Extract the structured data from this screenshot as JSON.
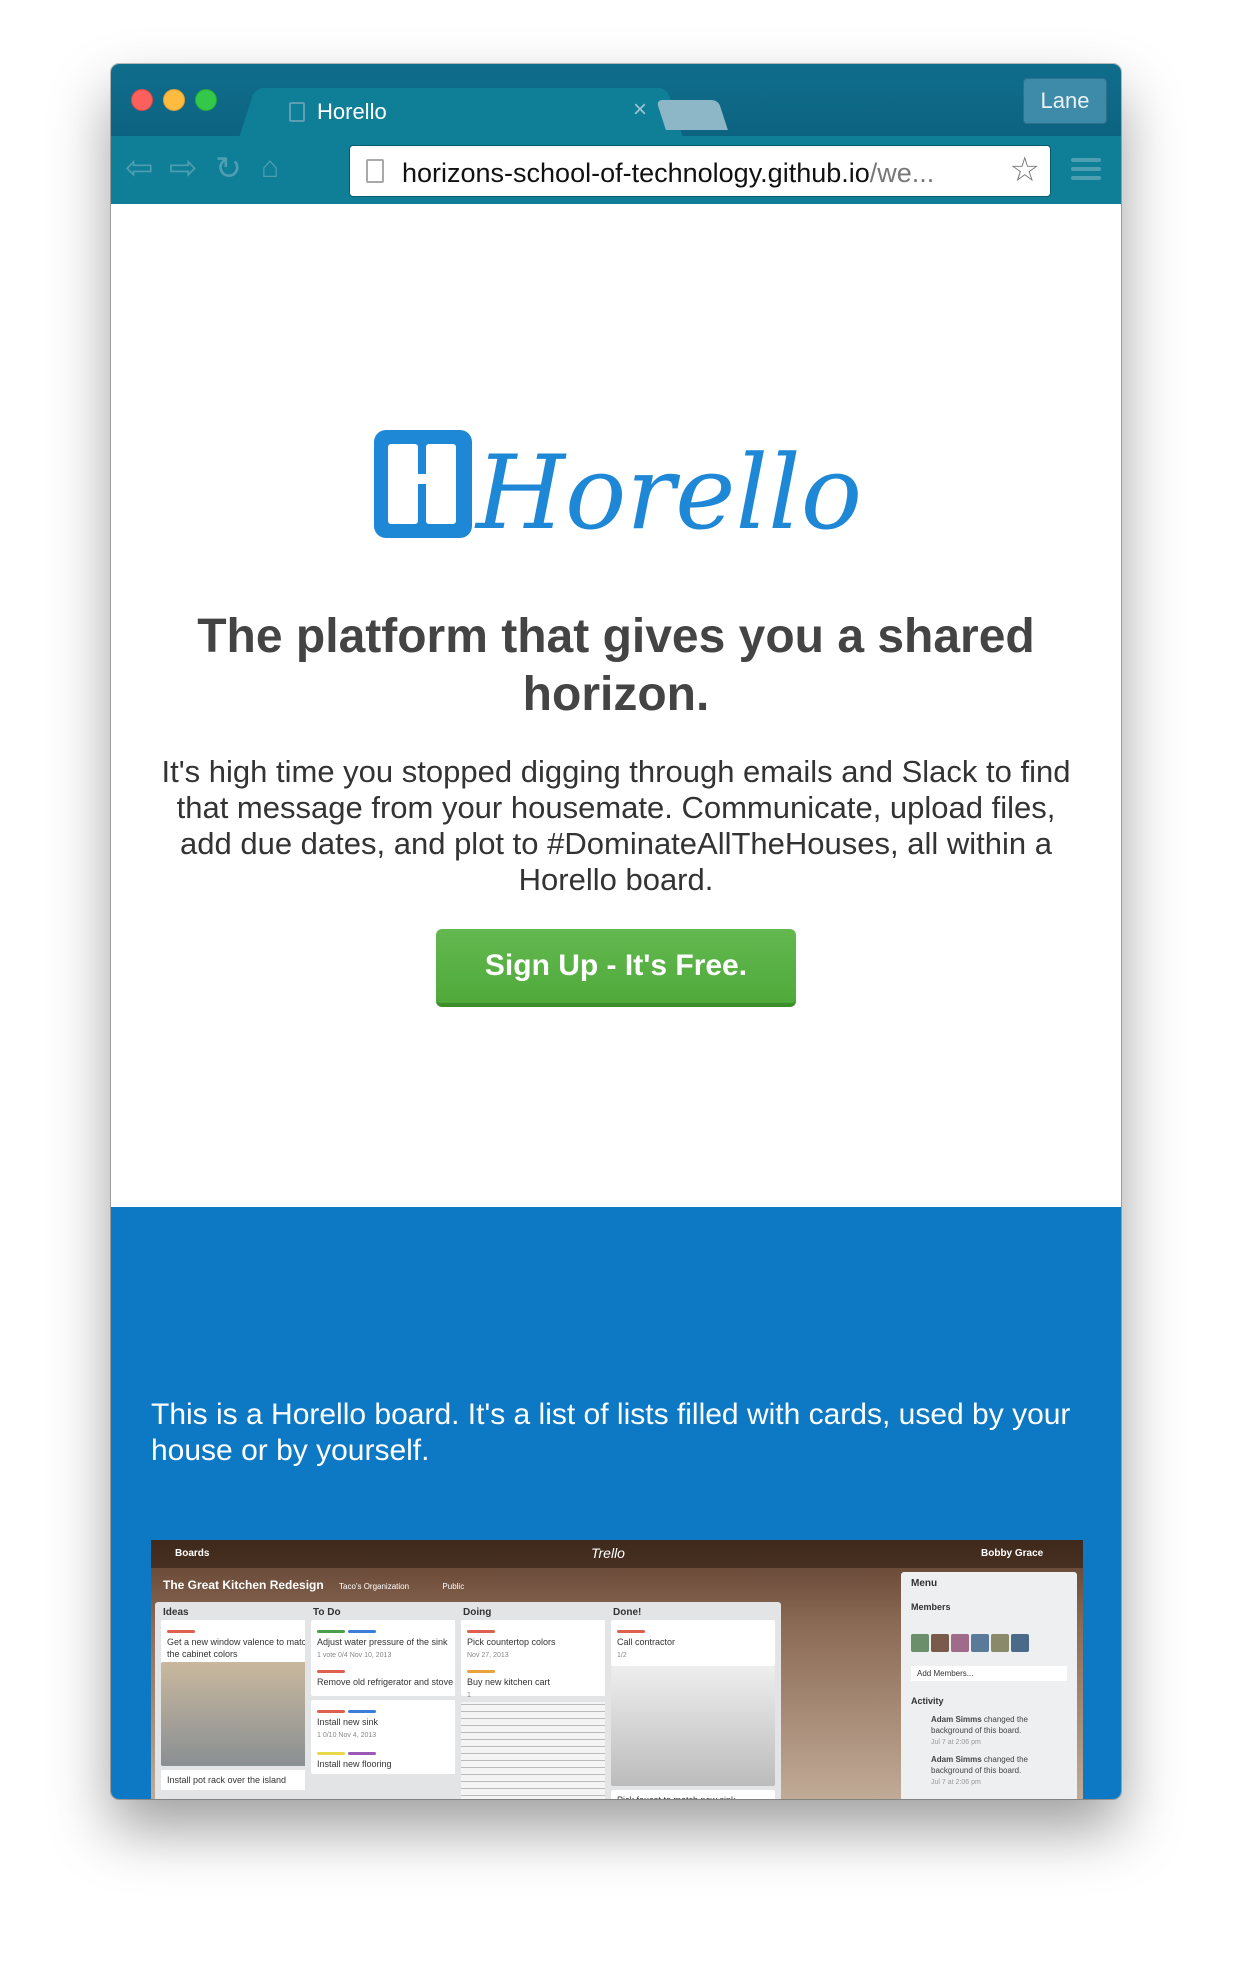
{
  "browser": {
    "tab_title": "Horello",
    "tab_close": "×",
    "profile_name": "Lane",
    "url_host": "horizons-school-of-technology.github.io",
    "url_path": "/we...",
    "nav_icons": [
      "back-arrow-icon",
      "forward-arrow-icon",
      "reload-icon",
      "home-icon"
    ],
    "accent_color": "#0f7e97"
  },
  "hero": {
    "logo_text": "Horello",
    "headline": "The platform that gives you a shared horizon.",
    "tagline": "It's high time you stopped digging through emails and Slack to find that message from your housemate. Communicate, upload files, add due dates, and plot to #DominateAllTheHouses, all within a Horello board.",
    "signup_label": "Sign Up - It's Free.",
    "signup_color": "#5cb346"
  },
  "board_section": {
    "background_color": "#0d78c4",
    "description": "This is a Horello board. It's a list of lists filled with cards, used by your house or by yourself."
  },
  "board_screenshot": {
    "boards_label": "Boards",
    "brand": "Trello",
    "user": "Bobby Grace",
    "board_title": "The Great Kitchen Redesign",
    "org": "Taco's Organization",
    "visibility": "Public",
    "lists": [
      {
        "name": "Ideas",
        "cards": [
          "Get a new window valence to match the cabinet colors",
          "Install pot rack over the island"
        ]
      },
      {
        "name": "To Do",
        "cards": [
          "Adjust water pressure of the sink",
          "Remove old refrigerator and stove",
          "Install new sink",
          "Install new flooring"
        ]
      },
      {
        "name": "Doing",
        "cards": [
          "Pick countertop colors",
          "Buy new kitchen cart"
        ]
      },
      {
        "name": "Done!",
        "cards": [
          "Call contractor",
          "Pick faucet to match new sink"
        ]
      }
    ],
    "badges": {
      "todo_1": "1 vote   0/4   Nov 10, 2013",
      "todo_3": "1   0/10   Nov 4, 2013",
      "doing_1": "Nov 27, 2013",
      "doing_2": "1",
      "done_1": "1/2"
    },
    "menu": {
      "title": "Menu",
      "members": "Members",
      "add_members": "Add Members...",
      "activity": "Activity",
      "activity_items": [
        {
          "who": "Adam Simms",
          "text": "changed the background of this board.",
          "when": "Jul 7 at 2:06 pm"
        },
        {
          "who": "Adam Simms",
          "text": "changed the background of this board.",
          "when": "Jul 7 at 2:06 pm"
        }
      ]
    }
  }
}
